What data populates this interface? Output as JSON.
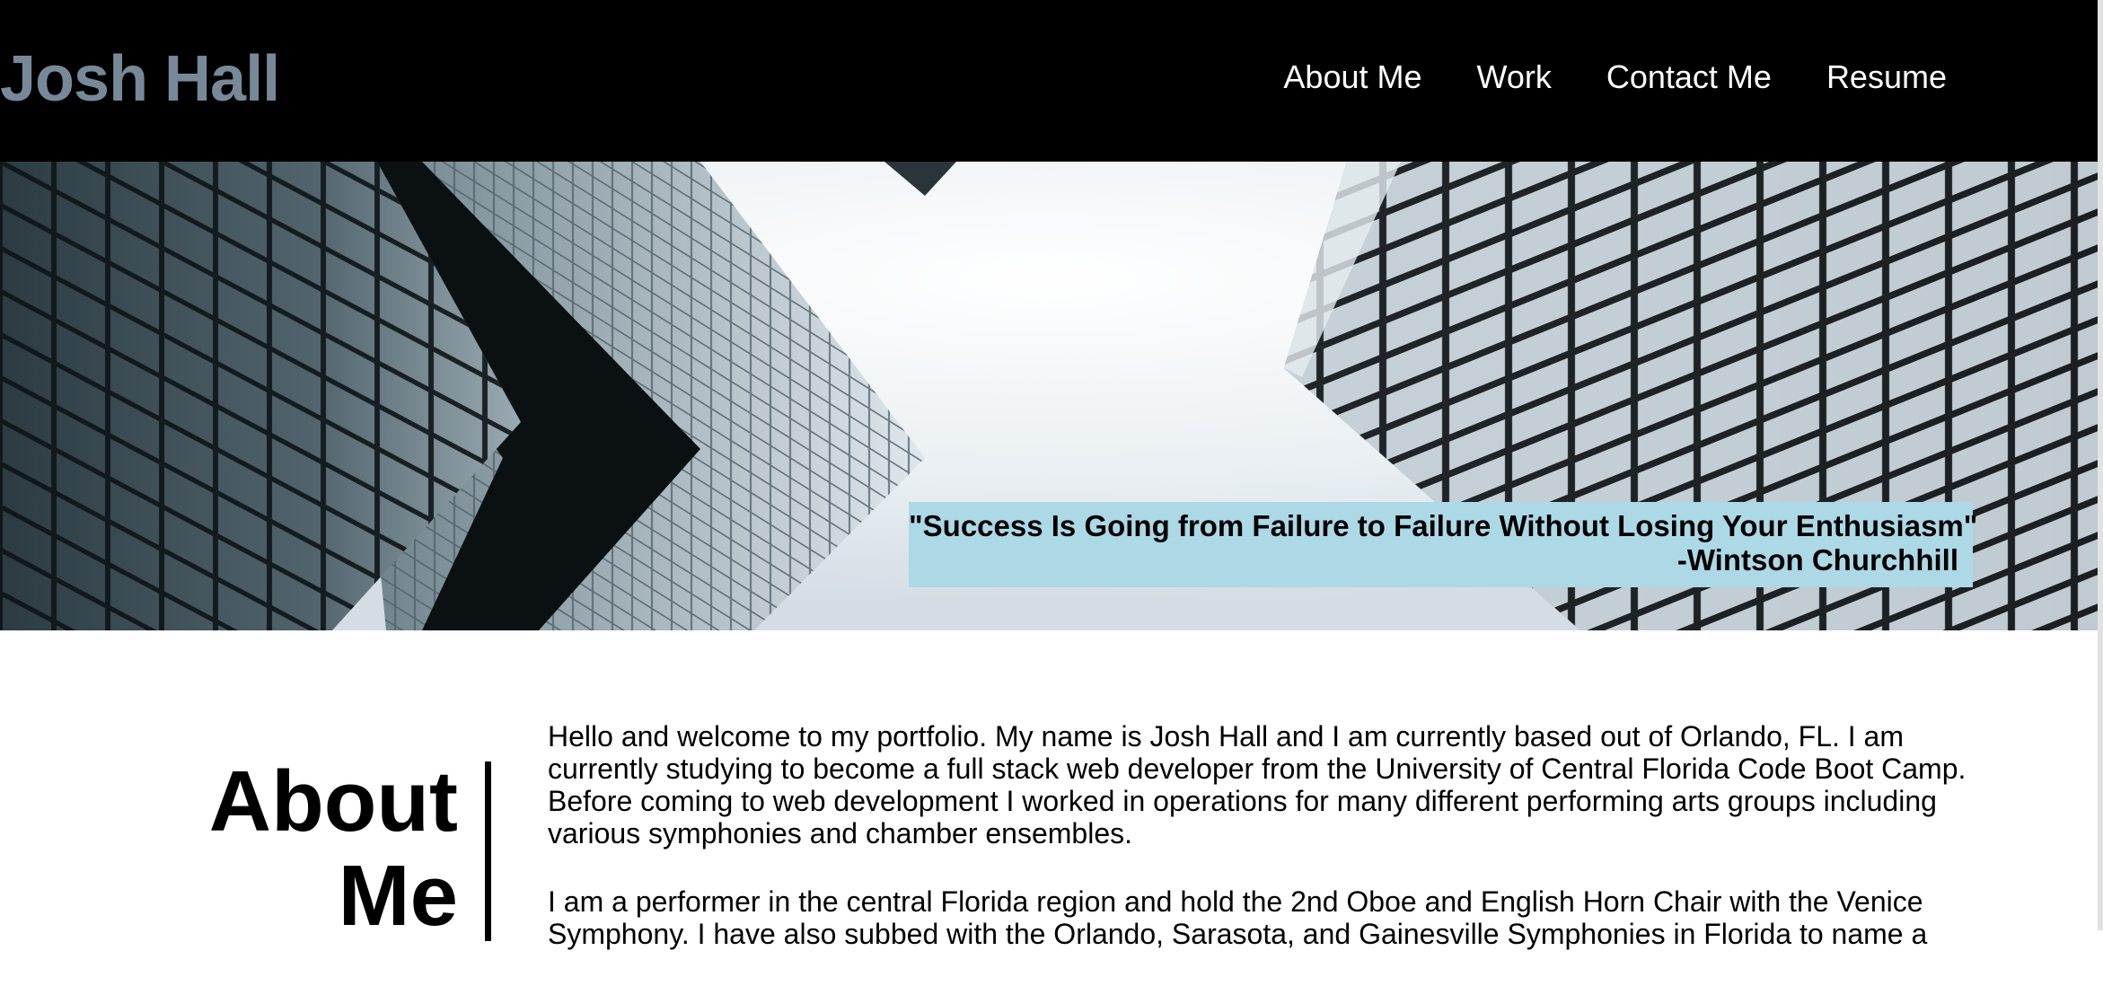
{
  "header": {
    "site_title": "Josh Hall",
    "nav": [
      "About Me",
      "Work",
      "Contact Me",
      "Resume"
    ]
  },
  "hero": {
    "image_subject": "skyscrapers viewed from below",
    "quote_line1": "\"Success Is Going from Failure to Failure Without Losing Your Enthusiasm\"",
    "quote_line2": "-Wintson Churchhill"
  },
  "about": {
    "title_line1": "About",
    "title_line2": "Me",
    "paragraphs": [
      "Hello and welcome to my portfolio. My name is Josh Hall and I am currently based out of Orlando, FL. I am currently studying to become a full stack web developer from the University of Central Florida Code Boot Camp. Before coming to web development I worked in operations for many different performing arts groups including various symphonies and chamber ensembles.",
      "I am a performer in the central Florida region and hold the 2nd Oboe and English Horn Chair with the Venice Symphony. I have also subbed with the Orlando, Sarasota, and Gainesville Symphonies in Florida to name a"
    ]
  },
  "colors": {
    "header_bg": "#000000",
    "brand_text": "#778899",
    "quote_bg": "#add8e6"
  }
}
